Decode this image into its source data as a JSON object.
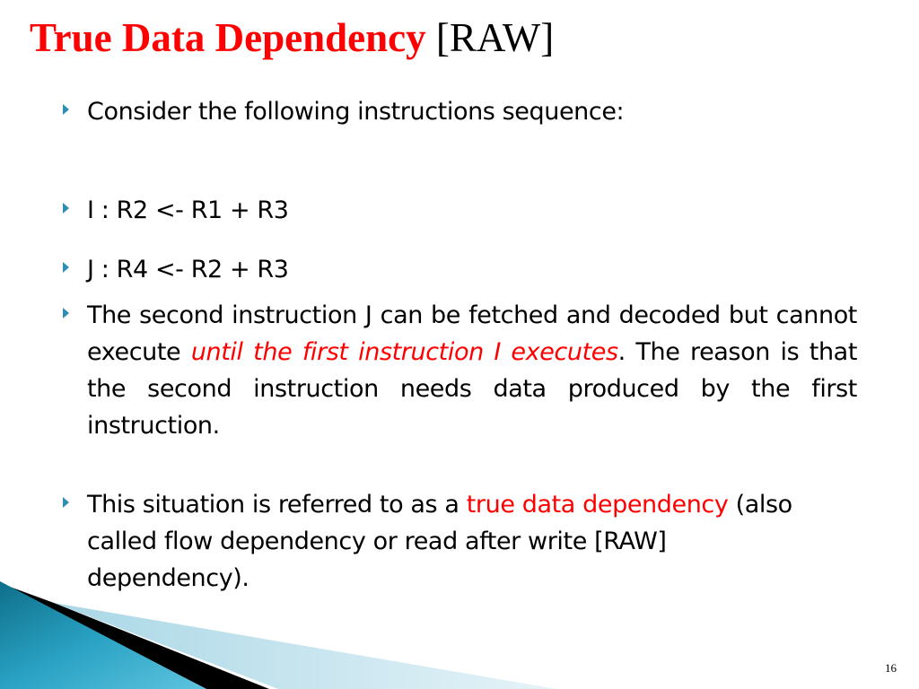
{
  "slide": {
    "title": {
      "main": "True Data Dependency",
      "suffix": "[RAW]"
    },
    "bullets": [
      {
        "text": "Consider the following instructions sequence:"
      },
      {
        "text": "I : R2 <- R1 + R3"
      },
      {
        "text": "J : R4 <- R2 + R3"
      },
      {
        "part1": "The second instruction J can be fetched and decoded but cannot execute ",
        "highlight": "until the first instruction  I executes",
        "part2": ". The reason is that the second instruction needs data produced by the first instruction."
      },
      {
        "part1": "This situation is referred to as a ",
        "highlight": "true data dependency",
        "part2": " (also called flow dependency or read after write [RAW] dependency)."
      }
    ],
    "page_number": "16",
    "colors": {
      "accent_red": "#ff0000",
      "bullet_teal": "#2e8fb3",
      "decor_teal": "#1e8aa8"
    },
    "icons": {
      "bullet": "triangle-bullet-icon"
    }
  }
}
